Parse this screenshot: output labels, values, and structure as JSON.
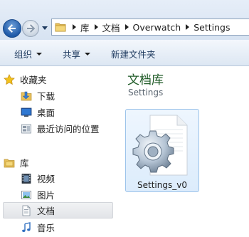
{
  "address_bar": {
    "breadcrumbs": [
      "库",
      "文档",
      "Overwatch",
      "Settings"
    ]
  },
  "toolbar": {
    "organize_label": "组织",
    "share_label": "共享",
    "new_folder_label": "新建文件夹"
  },
  "sidebar": {
    "favorites": {
      "label": "收藏夹",
      "items": [
        {
          "label": "下载",
          "icon": "downloads-folder-icon"
        },
        {
          "label": "桌面",
          "icon": "desktop-icon"
        },
        {
          "label": "最近访问的位置",
          "icon": "recent-places-icon"
        }
      ]
    },
    "libraries": {
      "label": "库",
      "items": [
        {
          "label": "视频",
          "icon": "videos-icon"
        },
        {
          "label": "图片",
          "icon": "pictures-icon"
        },
        {
          "label": "文档",
          "icon": "documents-icon",
          "selected": true
        },
        {
          "label": "音乐",
          "icon": "music-icon"
        }
      ]
    }
  },
  "content": {
    "library_title": "文档库",
    "library_subtitle": "Settings",
    "files": [
      {
        "name": "Settings_v0",
        "icon": "settings-file-icon"
      }
    ]
  }
}
